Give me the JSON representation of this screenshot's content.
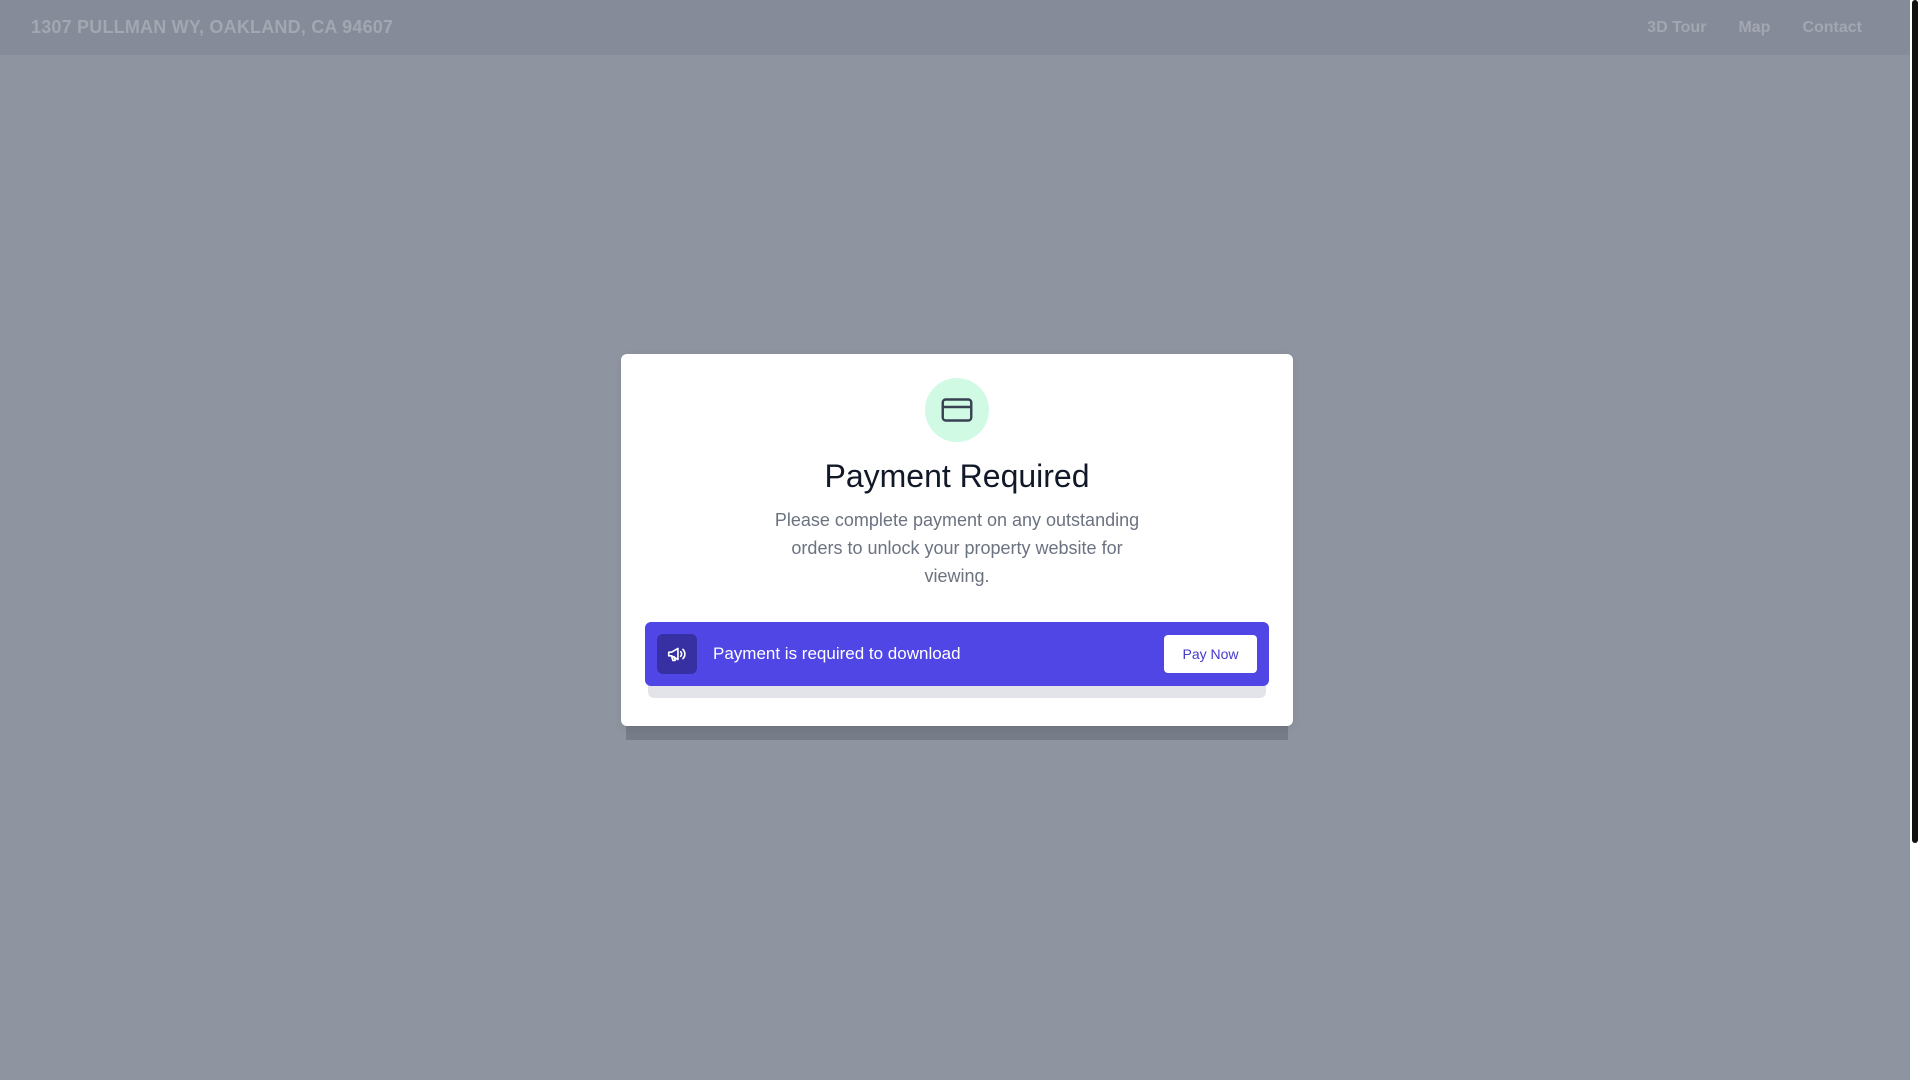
{
  "header": {
    "address": "1307 PULLMAN WY, OAKLAND, CA 94607",
    "nav": [
      "3D Tour",
      "Map",
      "Contact"
    ]
  },
  "modal": {
    "icon": "credit-card-icon",
    "title": "Payment Required",
    "body": "Please complete payment on any outstanding orders to unlock your property website for viewing.",
    "banner": {
      "icon": "megaphone-icon",
      "text": "Payment is required to download",
      "button_label": "Pay Now"
    }
  },
  "colors": {
    "overlay": "#8f95a0",
    "accent": "#4f46e5",
    "accent_dark": "#3730a3",
    "icon_bg": "#d1fae5",
    "title": "#111827",
    "body_text": "#6b7280"
  }
}
